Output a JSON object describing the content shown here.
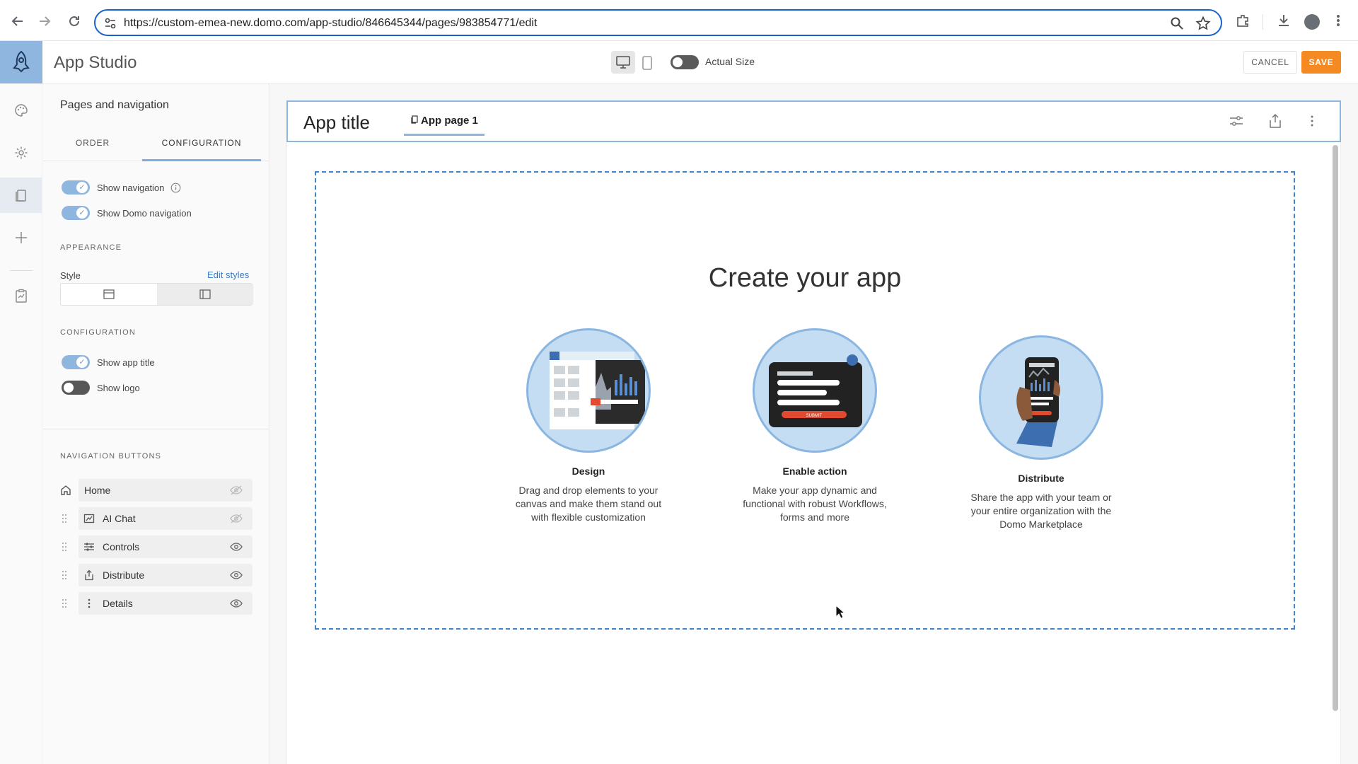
{
  "browser": {
    "url": "https://custom-emea-new.domo.com/app-studio/846645344/pages/983854771/edit"
  },
  "header": {
    "app_name": "App Studio",
    "actual_size_label": "Actual Size",
    "actual_size_on": false,
    "cancel_label": "CANCEL",
    "save_label": "SAVE"
  },
  "panel": {
    "title": "Pages and navigation",
    "tabs": [
      {
        "label": "ORDER",
        "active": false
      },
      {
        "label": "CONFIGURATION",
        "active": true
      }
    ],
    "show_navigation": {
      "label": "Show navigation",
      "on": true
    },
    "show_domo_navigation": {
      "label": "Show Domo navigation",
      "on": true
    },
    "appearance_heading": "APPEARANCE",
    "style_label": "Style",
    "edit_styles_label": "Edit styles",
    "configuration_heading": "CONFIGURATION",
    "show_app_title": {
      "label": "Show app title",
      "on": true
    },
    "show_logo": {
      "label": "Show logo",
      "on": false
    },
    "navigation_buttons_heading": "NAVIGATION BUTTONS",
    "nav_buttons": [
      {
        "label": "Home",
        "icon": "home-icon",
        "visible": false
      },
      {
        "label": "AI Chat",
        "icon": "ai-chat-icon",
        "visible": false
      },
      {
        "label": "Controls",
        "icon": "sliders-icon",
        "visible": true
      },
      {
        "label": "Distribute",
        "icon": "share-icon",
        "visible": true
      },
      {
        "label": "Details",
        "icon": "more-vertical-icon",
        "visible": true
      }
    ]
  },
  "canvas": {
    "app_title": "App title",
    "page_tab_label": "App page 1",
    "create_title": "Create your app",
    "features": [
      {
        "title": "Design",
        "description": "Drag and drop elements to your canvas and make them stand out with flexible customization"
      },
      {
        "title": "Enable action",
        "description": "Make your app dynamic and functional with robust Workflows, forms and more"
      },
      {
        "title": "Distribute",
        "description": "Share the app with your team or your entire organization with the Domo Marketplace"
      }
    ],
    "submit_button_text": "SUBMIT"
  },
  "colors": {
    "accent": "#8fb6df",
    "save": "#f58a22",
    "link": "#3d7cc9",
    "dropzone": "#3e83cc"
  }
}
